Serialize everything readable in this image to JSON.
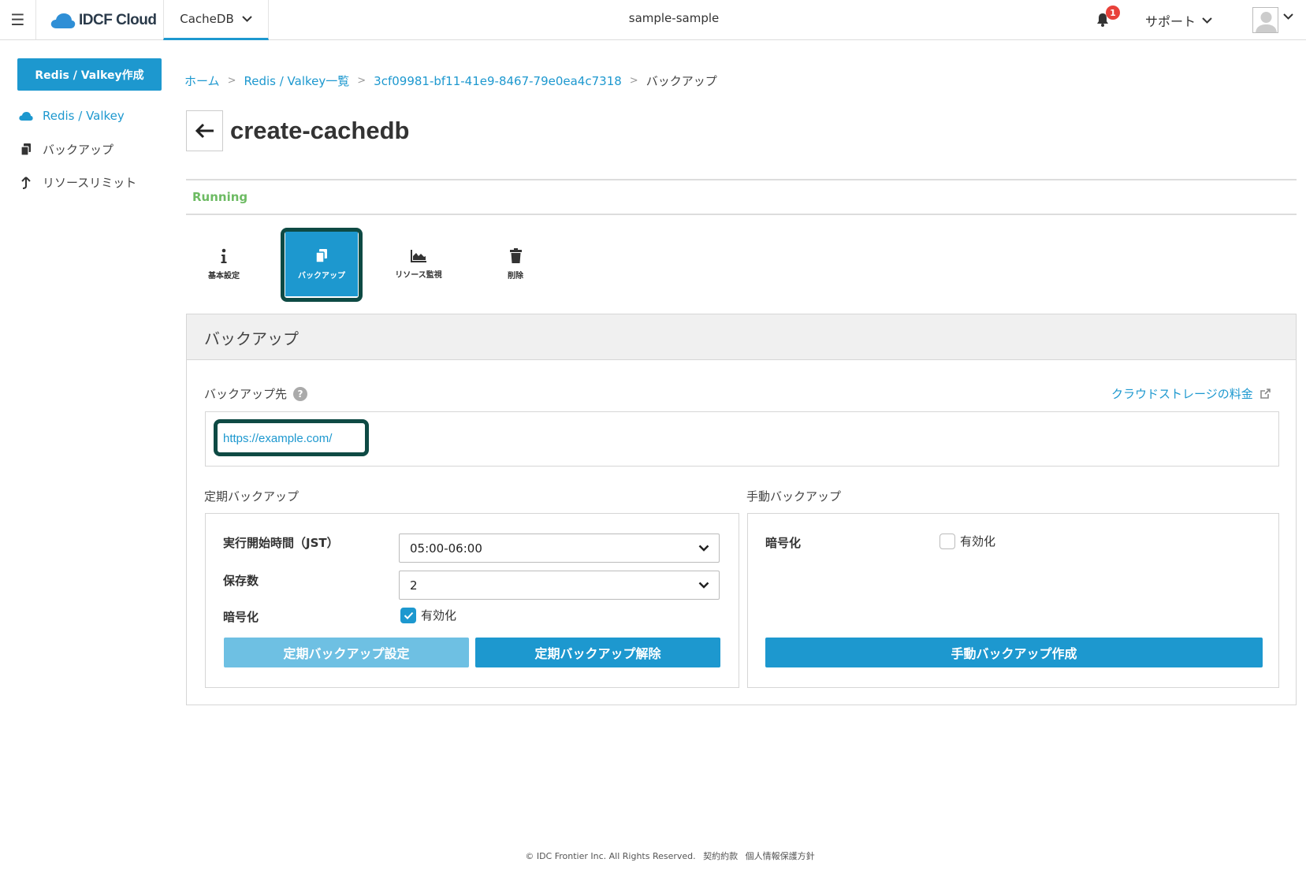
{
  "header": {
    "logo_text": "IDCF Cloud",
    "product": "CacheDB",
    "project": "sample-sample",
    "notification_count": "1",
    "support": "サポート"
  },
  "sidebar": {
    "create_button": "Redis / Valkey作成",
    "items": [
      {
        "label": "Redis / Valkey",
        "icon": "cloud-icon",
        "active": true
      },
      {
        "label": "バックアップ",
        "icon": "copy-icon",
        "active": false
      },
      {
        "label": "リソースリミット",
        "icon": "arrow-up-icon",
        "active": false
      }
    ]
  },
  "breadcrumb": {
    "home": "ホーム",
    "list": "Redis / Valkey一覧",
    "id": "3cf09981-bf11-41e9-8467-79e0ea4c7318",
    "current": "バックアップ",
    "sep": ">"
  },
  "page": {
    "title": "create-cachedb",
    "status": "Running"
  },
  "tabs": [
    {
      "label": "基本設定",
      "icon": "info-icon"
    },
    {
      "label": "バックアップ",
      "icon": "copy-icon",
      "active": true
    },
    {
      "label": "リソース監視",
      "icon": "area-chart-icon"
    },
    {
      "label": "削除",
      "icon": "trash-icon"
    }
  ],
  "backup": {
    "panel_title": "バックアップ",
    "dest_label": "バックアップ先",
    "storage_link": "クラウドストレージの料金",
    "dest_url": "https://example.com/",
    "scheduled": {
      "section_label": "定期バックアップ",
      "start_time_label": "実行開始時間（JST）",
      "start_time_value": "05:00-06:00",
      "retention_label": "保存数",
      "retention_value": "2",
      "encrypt_label": "暗号化",
      "encrypt_option": "有効化",
      "encrypt_checked": true,
      "set_button": "定期バックアップ設定",
      "cancel_button": "定期バックアップ解除"
    },
    "manual": {
      "section_label": "手動バックアップ",
      "encrypt_label": "暗号化",
      "encrypt_option": "有効化",
      "encrypt_checked": false,
      "create_button": "手動バックアップ作成"
    }
  },
  "footer": {
    "copyright": "© IDC Frontier Inc. All Rights Reserved.",
    "terms": "契約約款",
    "privacy": "個人情報保護方針"
  },
  "colors": {
    "accent": "#1d98cf",
    "status_running": "#6dbb63",
    "highlight_ring": "#0e4a44"
  }
}
